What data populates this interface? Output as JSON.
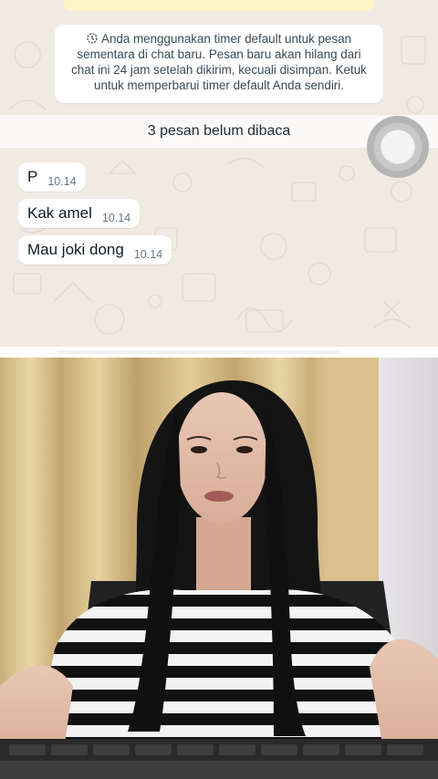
{
  "chat": {
    "system_message": "Anda menggunakan timer default untuk pesan sementara di chat baru. Pesan baru akan hilang dari chat ini 24 jam setelah dikirim, kecuali disimpan. Ketuk untuk memperbarui timer default Anda sendiri.",
    "unread_banner": "3 pesan belum dibaca",
    "messages": [
      {
        "text": "P",
        "time": "10.14"
      },
      {
        "text": "Kak amel",
        "time": "10.14"
      },
      {
        "text": "Mau joki dong",
        "time": "10.14"
      }
    ]
  },
  "colors": {
    "chat_background": "#efeae2",
    "bubble": "#ffffff",
    "time_text": "#667781"
  },
  "icons": {
    "system_message": "timer-icon",
    "scroll_button": "scroll-down-icon"
  }
}
